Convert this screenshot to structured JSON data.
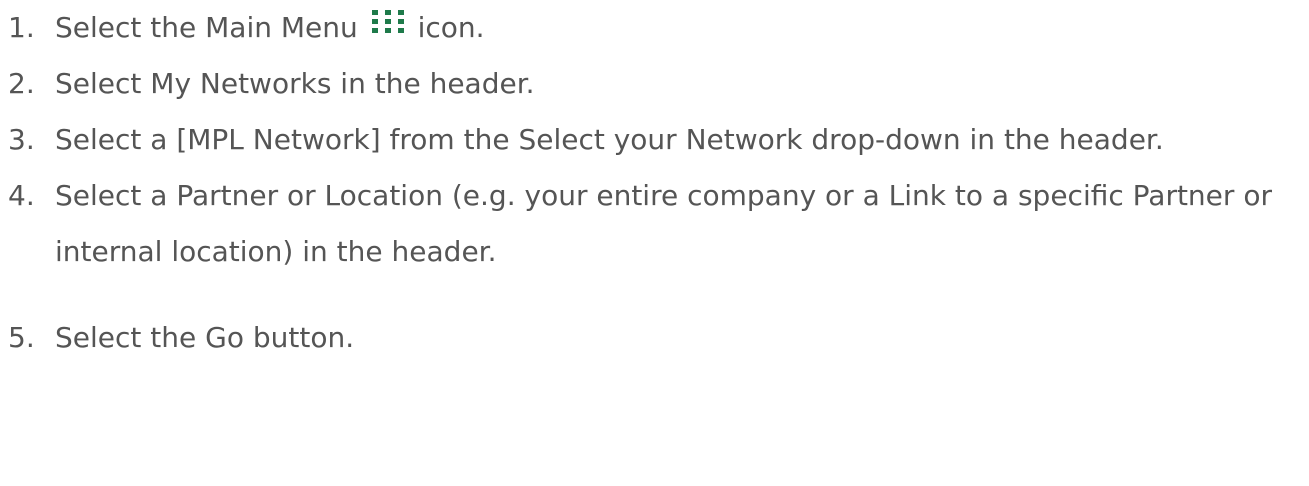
{
  "steps": [
    {
      "number": "1.",
      "text_before_icon": "Select the Main Menu",
      "icon": "grid-menu-icon",
      "text_after_icon": "icon."
    },
    {
      "number": "2.",
      "text": "Select My Networks in the header."
    },
    {
      "number": "3.",
      "text": "Select a [MPL Network] from the Select your Network drop-down in the header."
    },
    {
      "number": "4.",
      "text": "Select a Partner or Location (e.g. your entire company or a Link to a specific Partner or internal location) in the header."
    },
    {
      "number": "5.",
      "text": "Select the Go button."
    }
  ],
  "colors": {
    "text": "#555555",
    "icon": "#1e7a4a"
  }
}
